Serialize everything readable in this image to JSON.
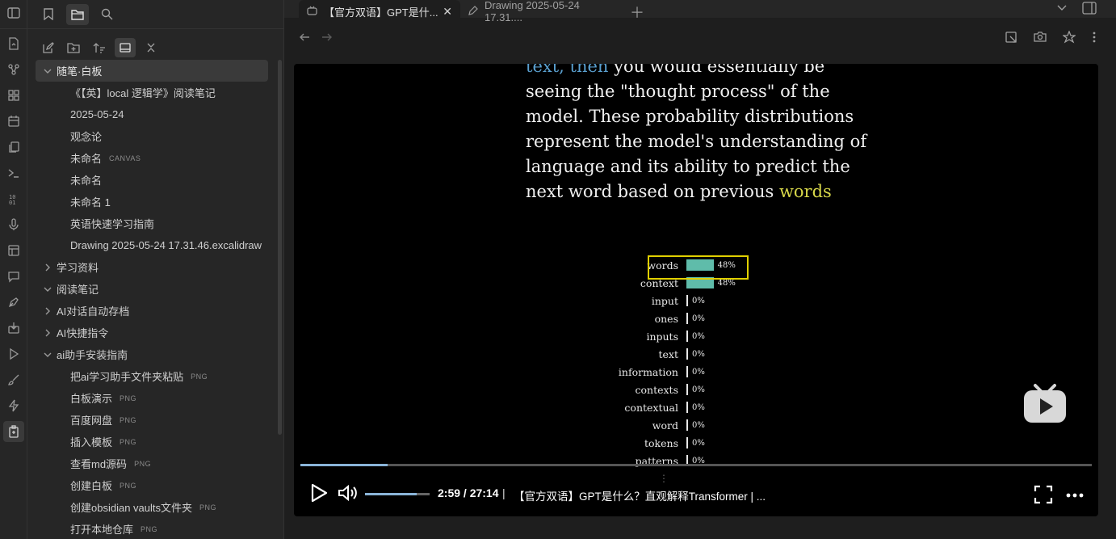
{
  "sidebar": {
    "tree": [
      {
        "kind": "folder",
        "label": "随笔·白板",
        "expanded": true,
        "selected": true
      },
      {
        "kind": "file",
        "label": "《【英】local 逻辑学》阅读笔记",
        "tag": ""
      },
      {
        "kind": "file",
        "label": "2025-05-24",
        "tag": ""
      },
      {
        "kind": "file",
        "label": "观念论",
        "tag": ""
      },
      {
        "kind": "file",
        "label": "未命名",
        "tag": "CANVAS"
      },
      {
        "kind": "file",
        "label": "未命名",
        "tag": ""
      },
      {
        "kind": "file",
        "label": "未命名 1",
        "tag": ""
      },
      {
        "kind": "file",
        "label": "英语快速学习指南",
        "tag": ""
      },
      {
        "kind": "file",
        "label": "Drawing 2025-05-24 17.31.46.excalidraw",
        "tag": ""
      },
      {
        "kind": "folder",
        "label": "学习资料",
        "expanded": false
      },
      {
        "kind": "folder",
        "label": "阅读笔记",
        "expanded": true
      },
      {
        "kind": "folder",
        "label": "AI对话自动存档",
        "expanded": false
      },
      {
        "kind": "folder",
        "label": "AI快捷指令",
        "expanded": false
      },
      {
        "kind": "folder",
        "label": "ai助手安装指南",
        "expanded": true
      },
      {
        "kind": "file",
        "label": "把ai学习助手文件夹粘贴",
        "tag": "PNG"
      },
      {
        "kind": "file",
        "label": "白板演示",
        "tag": "PNG"
      },
      {
        "kind": "file",
        "label": "百度网盘",
        "tag": "PNG"
      },
      {
        "kind": "file",
        "label": "插入模板",
        "tag": "PNG"
      },
      {
        "kind": "file",
        "label": "查看md源码",
        "tag": "PNG"
      },
      {
        "kind": "file",
        "label": "创建白板",
        "tag": "PNG"
      },
      {
        "kind": "file",
        "label": "创建obsidian vaults文件夹",
        "tag": "PNG"
      },
      {
        "kind": "file",
        "label": "打开本地仓库",
        "tag": "PNG"
      }
    ]
  },
  "tabs": [
    {
      "label": "【官方双语】GPT是什...",
      "icon": "media-icon"
    },
    {
      "label": "Drawing 2025-05-24 17.31....",
      "icon": "pen-icon"
    }
  ],
  "video": {
    "text_line_0a": "text, then",
    "text_line_0b": " you would essentially be",
    "text_line_1": "seeing the \"thought process\" of the",
    "text_line_2": "model. These probability distributions",
    "text_line_3": "represent the model's understanding of",
    "text_line_4": "language and its ability to predict the",
    "text_line_5a": "next word based on previous ",
    "text_line_5b": "words",
    "time": "2:59 / 27:14",
    "separator": "|",
    "title": "【官方双语】GPT是什么？直观解释Transformer | ...",
    "progress": 0.11,
    "volume": 0.8
  },
  "chart_data": {
    "type": "bar",
    "categories": [
      "words",
      "context",
      "input",
      "ones",
      "inputs",
      "text",
      "information",
      "contexts",
      "contextual",
      "word",
      "tokens",
      "patterns"
    ],
    "values": [
      48,
      48,
      0,
      0,
      0,
      0,
      0,
      0,
      0,
      0,
      0,
      0
    ],
    "labels": [
      "48%",
      "48%",
      "0%",
      "0%",
      "0%",
      "0%",
      "0%",
      "0%",
      "0%",
      "0%",
      "0%",
      "0%"
    ],
    "highlighted": "words",
    "colors": {
      "bar": "#5fbcaa",
      "highlight": "#e0d000"
    }
  }
}
